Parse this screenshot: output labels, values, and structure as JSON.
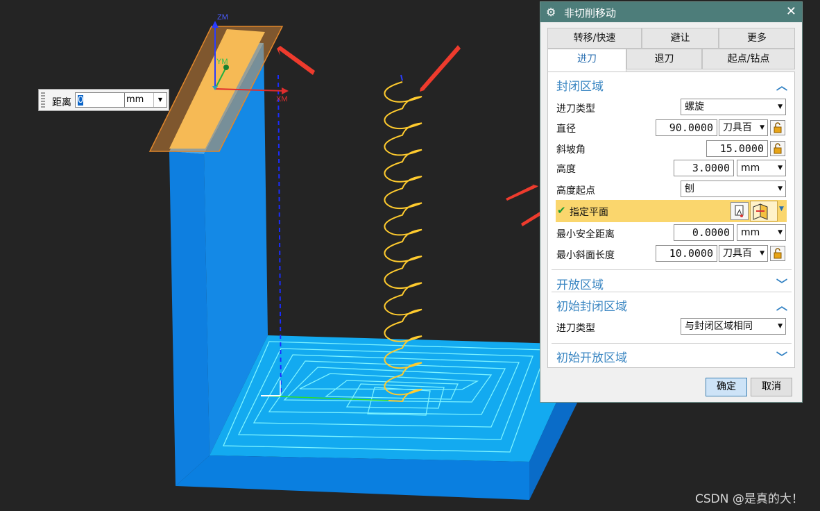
{
  "viewport": {
    "axis_labels": {
      "z": "ZM",
      "y": "YM",
      "x": "XM"
    },
    "distance_box": {
      "label": "距离",
      "value": "0",
      "unit": "mm"
    }
  },
  "dialog": {
    "title": "非切削移动",
    "icons": {
      "title": "gear-icon",
      "close": "close-icon"
    },
    "tabs_row1": [
      "转移/快速",
      "避让",
      "更多"
    ],
    "tabs_row2": [
      "进刀",
      "退刀",
      "起点/钻点"
    ],
    "active_tab": "进刀",
    "closed_area": {
      "heading": "封闭区域",
      "engage_type_label": "进刀类型",
      "engage_type_value": "螺旋",
      "diameter_label": "直径",
      "diameter_value": "90.0000",
      "diameter_unit": "刀具百",
      "ramp_angle_label": "斜坡角",
      "ramp_angle_value": "15.0000",
      "height_label": "高度",
      "height_value": "3.0000",
      "height_unit": "mm",
      "height_start_label": "高度起点",
      "height_start_value": "刨",
      "specify_plane_label": "指定平面",
      "min_clearance_label": "最小安全距离",
      "min_clearance_value": "0.0000",
      "min_clearance_unit": "mm",
      "min_ramp_length_label": "最小斜面长度",
      "min_ramp_length_value": "10.0000",
      "min_ramp_length_unit": "刀具百"
    },
    "open_area": {
      "heading": "开放区域"
    },
    "initial_closed_area": {
      "heading": "初始封闭区域",
      "engage_type_label": "进刀类型",
      "engage_type_value": "与封闭区域相同"
    },
    "initial_open_area": {
      "heading": "初始开放区域"
    },
    "ok_label": "确定",
    "cancel_label": "取消"
  },
  "watermark": "CSDN @是真的大！",
  "colors": {
    "part": "#0a82e6",
    "floor": "#13aff0",
    "path": "#ffcc33",
    "highlight": "#fad66d",
    "annot": "#ee3b2d"
  }
}
